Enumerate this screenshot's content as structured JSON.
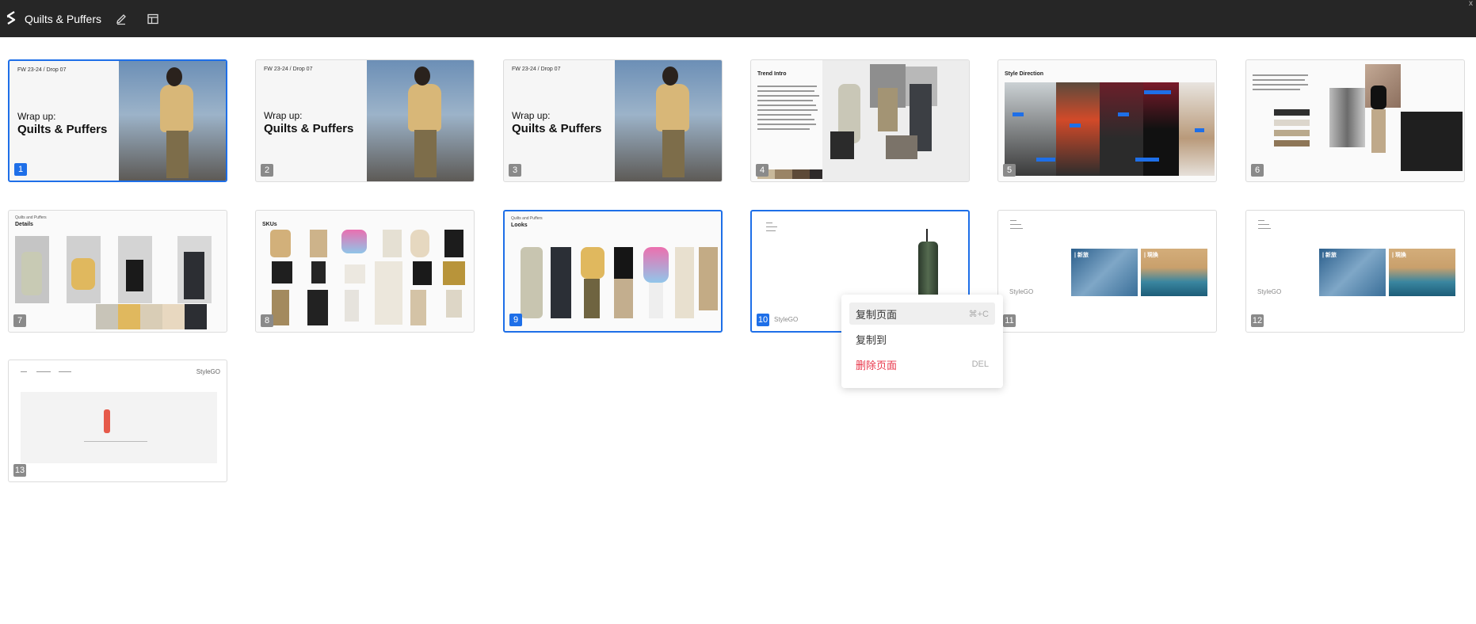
{
  "app": {
    "title": "Quilts & Puffers",
    "corner_close": "x"
  },
  "toolbar": {
    "edit_icon": "pencil-icon",
    "layout_icon": "layout-icon"
  },
  "slides": [
    {
      "number": "1",
      "header": "FW 23-24 / Drop 07",
      "line1": "Wrap up:",
      "line2": "Quilts & Puffers",
      "selected": true
    },
    {
      "number": "2",
      "header": "FW 23-24 / Drop 07",
      "line1": "Wrap up:",
      "line2": "Quilts & Puffers"
    },
    {
      "number": "3",
      "header": "FW 23-24 / Drop 07",
      "line1": "Wrap up:",
      "line2": "Quilts & Puffers"
    },
    {
      "number": "4",
      "header": "Trend Intro"
    },
    {
      "number": "5",
      "header": "Style Direction"
    },
    {
      "number": "6"
    },
    {
      "number": "7",
      "header": "Details"
    },
    {
      "number": "8",
      "header": "SKUs"
    },
    {
      "number": "9",
      "header": "Looks",
      "selected": true
    },
    {
      "number": "10",
      "brand": "StyleGO",
      "selected": true
    },
    {
      "number": "11",
      "brand": "StyleGO",
      "tag_a": "| 新旅",
      "tag_b": "| 現換"
    },
    {
      "number": "12",
      "brand": "StyleGO",
      "tag_a": "| 新旅",
      "tag_b": "| 現換"
    },
    {
      "number": "13",
      "brand": "StyleGO"
    }
  ],
  "context_menu": {
    "items": [
      {
        "label": "复制页面",
        "shortcut": "⌘+C"
      },
      {
        "label": "复制到",
        "shortcut": ""
      },
      {
        "label": "删除页面",
        "shortcut": "DEL"
      }
    ]
  },
  "colors": {
    "accent": "#1e6fe8",
    "danger": "#e8364a",
    "topbar": "#262626"
  }
}
